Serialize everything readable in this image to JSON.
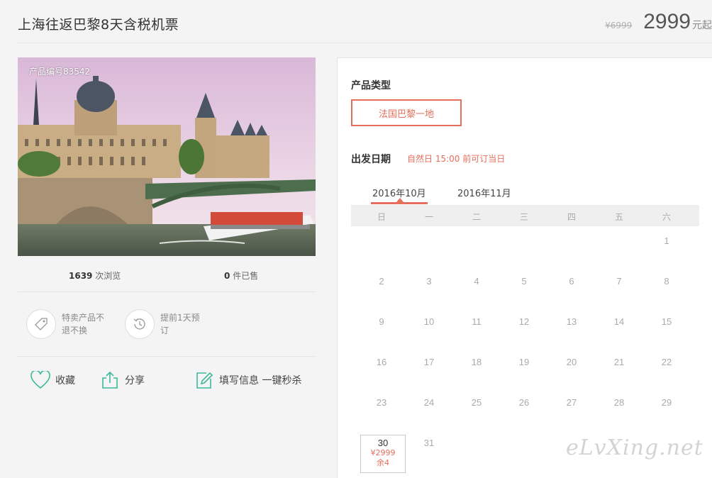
{
  "header": {
    "title": "上海往返巴黎8天含税机票",
    "old_price": "¥6999",
    "price": "2999",
    "price_unit": "元起"
  },
  "product": {
    "code": "产品编号83542"
  },
  "stats": {
    "views_count": "1639",
    "views_label": "次浏览",
    "sold_count": "0",
    "sold_label": "件已售"
  },
  "features": [
    {
      "icon": "tag-icon",
      "text": "特卖产品不退不换"
    },
    {
      "icon": "clock-history-icon",
      "text": "提前1天预订"
    }
  ],
  "actions": {
    "favorite": "收藏",
    "share": "分享",
    "fill_info": "填写信息 一键秒杀"
  },
  "booking": {
    "type_label": "产品类型",
    "type_option": "法国巴黎一地",
    "date_label": "出发日期",
    "date_notice": "自然日 15:00 前可订当日",
    "months": [
      "2016年10月",
      "2016年11月"
    ],
    "weekdays": [
      "日",
      "一",
      "二",
      "三",
      "四",
      "五",
      "六"
    ],
    "days": [
      "1",
      "2",
      "3",
      "4",
      "5",
      "6",
      "7",
      "8",
      "9",
      "10",
      "11",
      "12",
      "13",
      "14",
      "15",
      "16",
      "17",
      "18",
      "19",
      "20",
      "21",
      "22",
      "23",
      "24",
      "25",
      "26",
      "27",
      "28",
      "29",
      "30",
      "31"
    ],
    "available_day": {
      "day": "30",
      "price": "¥2999",
      "stock": "余4"
    }
  },
  "watermark": "eLvXing.net",
  "colors": {
    "accent": "#e66e5c",
    "icon_green": "#3bb99a"
  }
}
